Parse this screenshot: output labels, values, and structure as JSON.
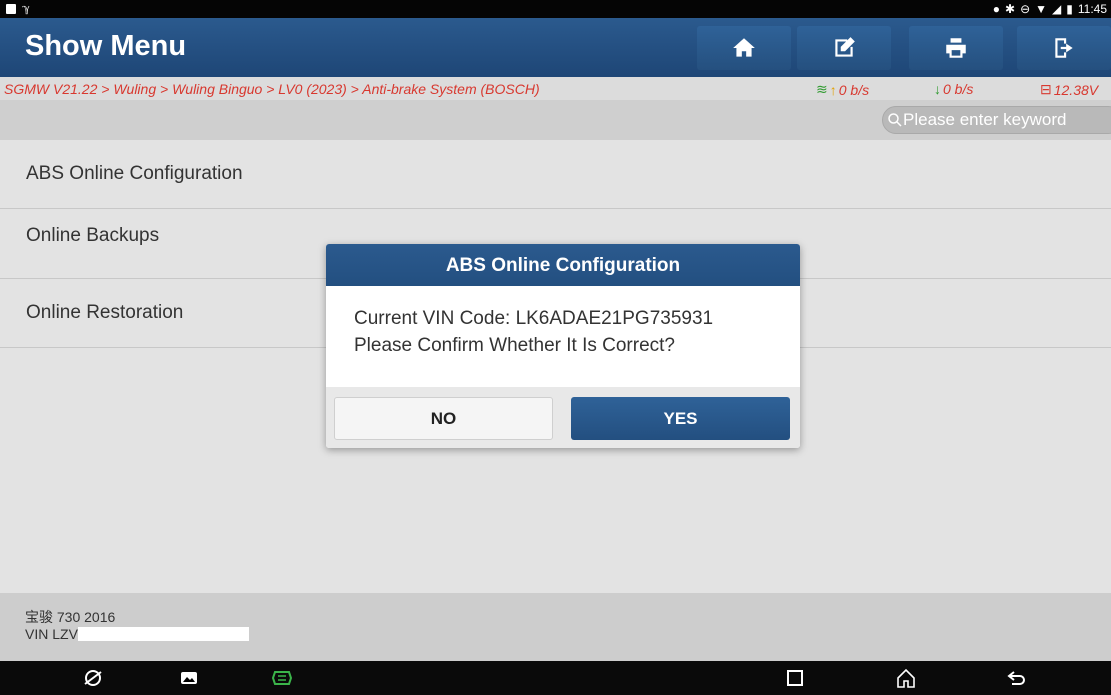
{
  "status_bar": {
    "time": "11:45"
  },
  "header": {
    "title": "Show Menu",
    "buttons": [
      {
        "icon": "home-icon"
      },
      {
        "icon": "edit-icon"
      },
      {
        "icon": "print-icon"
      },
      {
        "icon": "exit-icon"
      }
    ]
  },
  "breadcrumb": {
    "path": "SGMW V21.22 > Wuling > Wuling Binguo > LV0 (2023) > Anti-brake System (BOSCH)",
    "upload_rate": "0 b/s",
    "download_rate": "0 b/s",
    "voltage": "12.38V"
  },
  "search": {
    "placeholder": "Please enter keyword"
  },
  "menu": {
    "items": [
      {
        "label": "ABS Online Configuration"
      },
      {
        "label": "Online Backups"
      },
      {
        "label": "Online Restoration"
      }
    ]
  },
  "footer": {
    "car": "宝骏 730 2016",
    "vin_label": "VIN LZV"
  },
  "dialog": {
    "title": "ABS Online Configuration",
    "line1": "Current VIN Code: LK6ADAE21PG735931",
    "line2": "Please Confirm Whether It Is Correct?",
    "no_label": "NO",
    "yes_label": "YES"
  },
  "colors": {
    "header_blue": "#2b5a8e",
    "breadcrumb_red": "#d8382f",
    "upload_arrow": "#e2a000",
    "download_arrow": "#2e9a2e",
    "vci_green": "#3bb54a"
  }
}
